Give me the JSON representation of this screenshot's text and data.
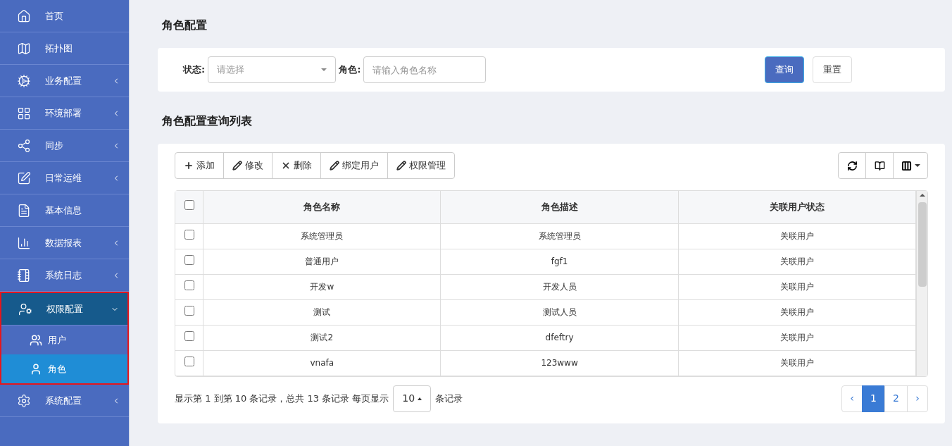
{
  "sidebar": {
    "items": [
      {
        "label": "首页",
        "has_submenu": false,
        "selected": false
      },
      {
        "label": "拓扑图",
        "has_submenu": false,
        "selected": false
      },
      {
        "label": "业务配置",
        "has_submenu": true,
        "expanded": false,
        "selected": false
      },
      {
        "label": "环境部署",
        "has_submenu": true,
        "expanded": false,
        "selected": false
      },
      {
        "label": "同步",
        "has_submenu": true,
        "expanded": false,
        "selected": false
      },
      {
        "label": "日常运维",
        "has_submenu": true,
        "expanded": false,
        "selected": false
      },
      {
        "label": "基本信息",
        "has_submenu": false,
        "selected": false
      },
      {
        "label": "数据报表",
        "has_submenu": true,
        "expanded": false,
        "selected": false
      },
      {
        "label": "系统日志",
        "has_submenu": true,
        "expanded": false,
        "selected": false
      },
      {
        "label": "权限配置",
        "has_submenu": true,
        "expanded": true,
        "selected": true,
        "children": [
          {
            "label": "用户",
            "selected": false
          },
          {
            "label": "角色",
            "selected": true
          }
        ]
      },
      {
        "label": "系统配置",
        "has_submenu": true,
        "expanded": false,
        "selected": false
      }
    ]
  },
  "page_title": "角色配置",
  "filter": {
    "status_label": "状态:",
    "status_placeholder": "请选择",
    "role_label": "角色:",
    "role_placeholder": "请输入角色名称",
    "buttons": [
      {
        "label": "查询",
        "kind": "primary"
      },
      {
        "label": "重置",
        "kind": "default"
      }
    ]
  },
  "list_title": "角色配置查询列表",
  "toolbar": [
    {
      "label": "添加",
      "kind": "add"
    },
    {
      "label": "修改",
      "kind": "edit"
    },
    {
      "label": "删除",
      "kind": "delete"
    },
    {
      "label": "绑定用户",
      "kind": "edit"
    },
    {
      "label": "权限管理",
      "kind": "edit"
    }
  ],
  "table": {
    "header_checked": false,
    "columns": [
      "角色名称",
      "角色描述",
      "关联用户状态"
    ],
    "rows": [
      {
        "checked": false,
        "cells": [
          "系统管理员",
          "系统管理员",
          "关联用户"
        ]
      },
      {
        "checked": false,
        "cells": [
          "普通用户",
          "fgf1",
          "关联用户"
        ]
      },
      {
        "checked": false,
        "cells": [
          "开发w",
          "开发人员",
          "关联用户"
        ]
      },
      {
        "checked": false,
        "cells": [
          "测试",
          "测试人员",
          "关联用户"
        ]
      },
      {
        "checked": false,
        "cells": [
          "测试2",
          "dfeftry",
          "关联用户"
        ]
      },
      {
        "checked": false,
        "cells": [
          "vnafa",
          "123www",
          "关联用户"
        ]
      }
    ]
  },
  "footer": {
    "summary": "显示第 1 到第 10 条记录，总共 13 条记录 每页显示",
    "page_size": "10",
    "suffix": "条记录"
  },
  "pagination": {
    "prev": "‹",
    "next": "›",
    "pages": [
      {
        "label": "1",
        "selected": true
      },
      {
        "label": "2",
        "selected": false
      }
    ]
  }
}
